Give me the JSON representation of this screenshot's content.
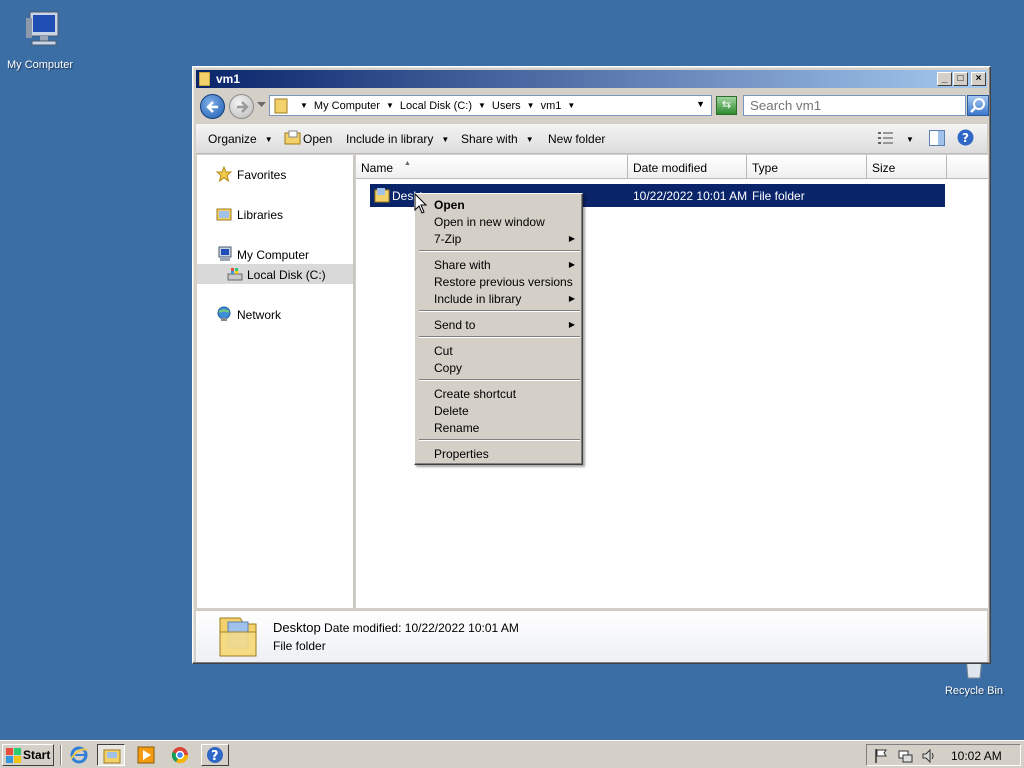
{
  "desktop": {
    "icons": [
      {
        "label": "My Computer"
      },
      {
        "label": "Recycle Bin"
      }
    ]
  },
  "window": {
    "title": "vm1",
    "breadcrumb": [
      "My Computer",
      "Local Disk (C:)",
      "Users",
      "vm1"
    ],
    "search_placeholder": "Search vm1",
    "commands": {
      "organize": "Organize",
      "open": "Open",
      "include_in_library": "Include in library",
      "share_with": "Share with",
      "new_folder": "New folder"
    },
    "nav": {
      "favorites": "Favorites",
      "libraries": "Libraries",
      "my_computer": "My Computer",
      "local_disk": "Local Disk (C:)",
      "network": "Network"
    },
    "columns": {
      "name": "Name",
      "date_modified": "Date modified",
      "type": "Type",
      "size": "Size"
    },
    "files": [
      {
        "name": "Desktop",
        "date_modified": "10/22/2022 10:01 AM",
        "type": "File folder",
        "size": ""
      }
    ],
    "details": {
      "name": "Desktop",
      "date_label": "Date modified:",
      "date_value": "10/22/2022 10:01 AM",
      "type": "File folder"
    }
  },
  "context_menu": {
    "items": [
      {
        "label": "Open",
        "bold": true
      },
      {
        "label": "Open in new window"
      },
      {
        "label": "7-Zip",
        "submenu": true
      },
      {
        "label": "Share with",
        "submenu": true
      },
      {
        "label": "Restore previous versions"
      },
      {
        "label": "Include in library",
        "submenu": true
      },
      {
        "label": "Send to",
        "submenu": true
      },
      {
        "label": "Cut"
      },
      {
        "label": "Copy"
      },
      {
        "label": "Create shortcut"
      },
      {
        "label": "Delete"
      },
      {
        "label": "Rename"
      },
      {
        "label": "Properties"
      }
    ]
  },
  "taskbar": {
    "start_label": "Start",
    "clock": "10:02 AM"
  },
  "colors": {
    "desktop_bg": "#3a6ea5",
    "selection": "#0a246a",
    "face": "#d4d0c8"
  }
}
